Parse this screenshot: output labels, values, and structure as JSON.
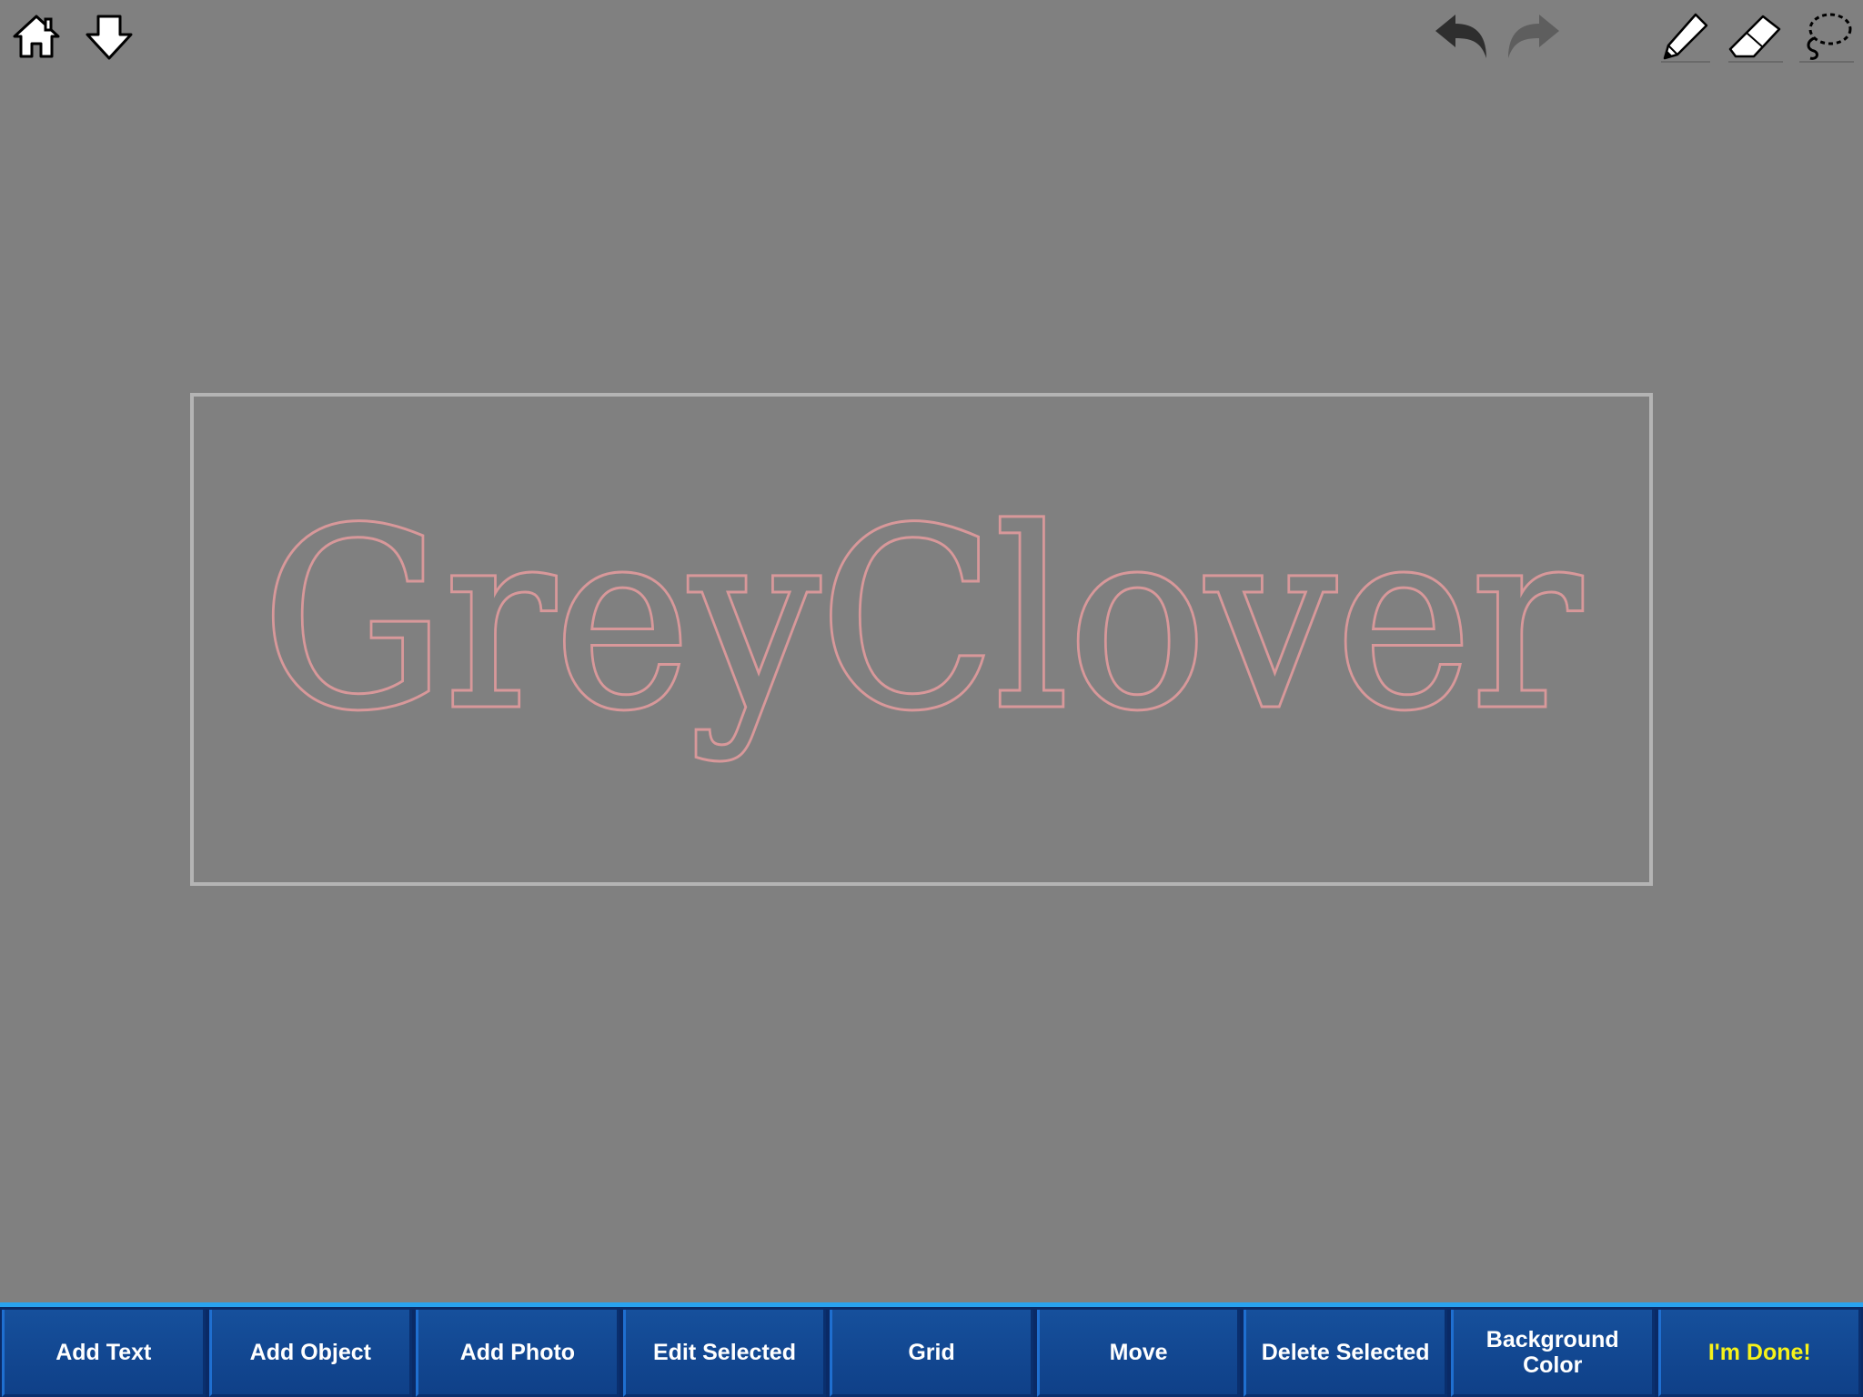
{
  "toolbar": {
    "left_icons": [
      "home-icon",
      "download-icon"
    ],
    "right_icons": [
      "undo-icon",
      "redo-icon",
      "pencil-icon",
      "eraser-icon",
      "lasso-icon"
    ]
  },
  "canvas": {
    "text": "GreyClover",
    "text_color": "#d8989a",
    "background_color": "#808080"
  },
  "bottom_bar": {
    "buttons": [
      {
        "label": "Add Text"
      },
      {
        "label": "Add Object"
      },
      {
        "label": "Add Photo"
      },
      {
        "label": "Edit Selected"
      },
      {
        "label": "Grid"
      },
      {
        "label": "Move"
      },
      {
        "label": "Delete Selected"
      },
      {
        "label": "Background\nColor"
      },
      {
        "label": "I'm Done!"
      }
    ],
    "done_color": "#f6f21a"
  }
}
